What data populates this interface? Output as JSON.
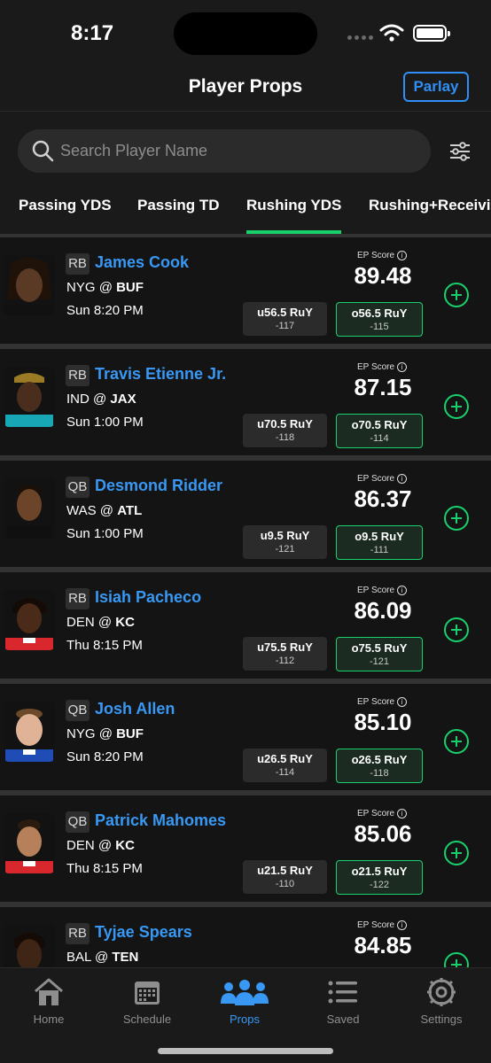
{
  "status_bar": {
    "time": "8:17"
  },
  "header": {
    "title": "Player Props",
    "parlay_label": "Parlay"
  },
  "search": {
    "placeholder": "Search Player Name",
    "value": ""
  },
  "tabs": [
    {
      "label": "Passing YDS"
    },
    {
      "label": "Passing TD"
    },
    {
      "label": "Rushing YDS",
      "active": true
    },
    {
      "label": "Rushing+Receivin"
    }
  ],
  "players": [
    {
      "position": "RB",
      "name": "James Cook",
      "away": "NYG",
      "at": "@",
      "home": "BUF",
      "time": "Sun 8:20 PM",
      "ep_label": "EP Score",
      "ep_score": "89.48",
      "under_line": "u56.5 RuY",
      "under_odds": "-117",
      "over_line": "o56.5 RuY",
      "over_odds": "-115"
    },
    {
      "position": "RB",
      "name": "Travis Etienne Jr.",
      "away": "IND",
      "at": "@",
      "home": "JAX",
      "time": "Sun 1:00 PM",
      "ep_label": "EP Score",
      "ep_score": "87.15",
      "under_line": "u70.5 RuY",
      "under_odds": "-118",
      "over_line": "o70.5 RuY",
      "over_odds": "-114"
    },
    {
      "position": "QB",
      "name": "Desmond Ridder",
      "away": "WAS",
      "at": "@",
      "home": "ATL",
      "time": "Sun 1:00 PM",
      "ep_label": "EP Score",
      "ep_score": "86.37",
      "under_line": "u9.5 RuY",
      "under_odds": "-121",
      "over_line": "o9.5 RuY",
      "over_odds": "-111"
    },
    {
      "position": "RB",
      "name": "Isiah Pacheco",
      "away": "DEN",
      "at": "@",
      "home": "KC",
      "time": "Thu 8:15 PM",
      "ep_label": "EP Score",
      "ep_score": "86.09",
      "under_line": "u75.5 RuY",
      "under_odds": "-112",
      "over_line": "o75.5 RuY",
      "over_odds": "-121"
    },
    {
      "position": "QB",
      "name": "Josh Allen",
      "away": "NYG",
      "at": "@",
      "home": "BUF",
      "time": "Sun 8:20 PM",
      "ep_label": "EP Score",
      "ep_score": "85.10",
      "under_line": "u26.5 RuY",
      "under_odds": "-114",
      "over_line": "o26.5 RuY",
      "over_odds": "-118"
    },
    {
      "position": "QB",
      "name": "Patrick Mahomes",
      "away": "DEN",
      "at": "@",
      "home": "KC",
      "time": "Thu 8:15 PM",
      "ep_label": "EP Score",
      "ep_score": "85.06",
      "under_line": "u21.5 RuY",
      "under_odds": "-110",
      "over_line": "o21.5 RuY",
      "over_odds": "-122"
    },
    {
      "position": "RB",
      "name": "Tyjae Spears",
      "away": "BAL",
      "at": "@",
      "home": "TEN",
      "time": "",
      "ep_label": "EP Score",
      "ep_score": "84.85",
      "under_line": "",
      "under_odds": "",
      "over_line": "",
      "over_odds": ""
    }
  ],
  "bottom_nav": [
    {
      "label": "Home",
      "icon": "home-icon"
    },
    {
      "label": "Schedule",
      "icon": "calendar-icon"
    },
    {
      "label": "Props",
      "icon": "people-icon",
      "active": true
    },
    {
      "label": "Saved",
      "icon": "list-icon"
    },
    {
      "label": "Settings",
      "icon": "gear-icon"
    }
  ],
  "colors": {
    "accent_green": "#19d16c",
    "link_blue": "#3898f3",
    "background": "#121212"
  }
}
